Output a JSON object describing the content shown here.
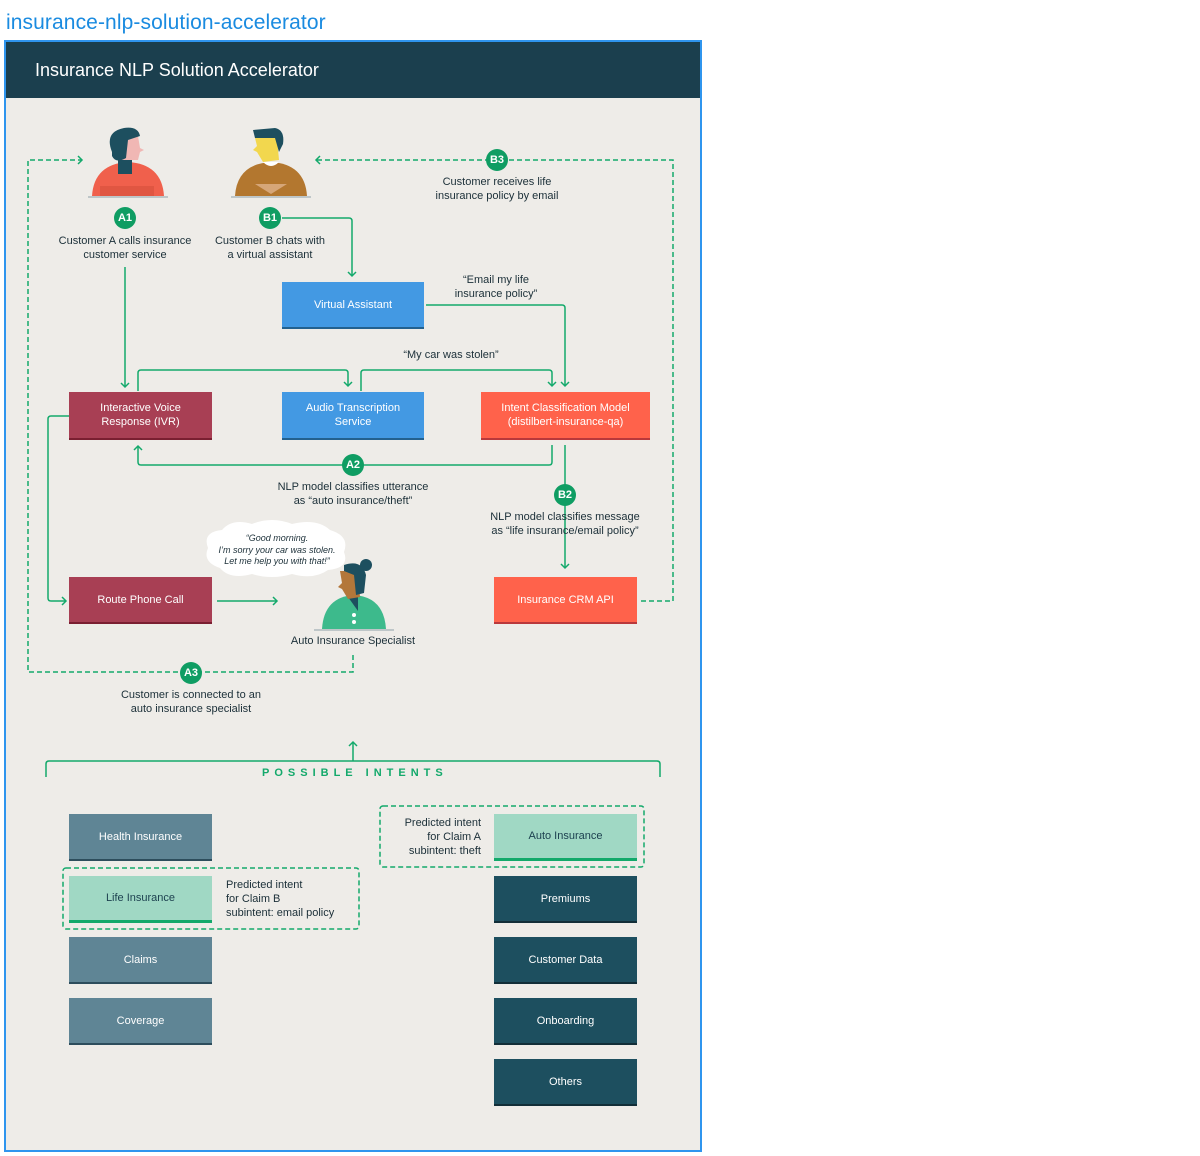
{
  "page": {
    "title": "insurance-nlp-solution-accelerator"
  },
  "header": {
    "title": "Insurance NLP Solution Accelerator"
  },
  "colors": {
    "accent_green": "#13a96b",
    "badge_green": "#0f9d63",
    "header_bg": "#1b3f4e",
    "canvas_bg": "#eeece8",
    "frame_border": "#2f95ee",
    "ivr_red": "#a83f54",
    "service_blue": "#4399e3",
    "model_orange": "#ff624b",
    "intent_slate": "#5f8595",
    "intent_dark": "#1d4f5f",
    "intent_highlight": "#a0d8c4"
  },
  "steps": {
    "a1": {
      "badge": "A1",
      "text_line1": "Customer A calls insurance",
      "text_line2": "customer service"
    },
    "b1": {
      "badge": "B1",
      "text_line1": "Customer B chats with",
      "text_line2": "a virtual assistant"
    },
    "b3": {
      "badge": "B3",
      "text_line1": "Customer receives life",
      "text_line2": "insurance policy by email"
    },
    "a2": {
      "badge": "A2",
      "text_line1": "NLP model classifies utterance",
      "text_line2": "as “auto insurance/theft”"
    },
    "b2": {
      "badge": "B2",
      "text_line1": "NLP model classifies message",
      "text_line2": "as “life insurance/email policy”"
    },
    "a3": {
      "badge": "A3",
      "text_line1": "Customer is connected to an",
      "text_line2": "auto insurance specialist"
    }
  },
  "quotes": {
    "email_policy_line1": "“Email my life",
    "email_policy_line2": "insurance policy”",
    "car_stolen": "“My car was stolen”",
    "specialist_line1": "“Good morning.",
    "specialist_line2": "I’m sorry your car was stolen.",
    "specialist_line3": "Let me help you with that!”"
  },
  "nodes": {
    "virtual_assistant": "Virtual Assistant",
    "ivr_line1": "Interactive Voice",
    "ivr_line2": "Response (IVR)",
    "audio_line1": "Audio Transcription",
    "audio_line2": "Service",
    "model_line1": "Intent Classification Model",
    "model_line2": "(distilbert-insurance-qa)",
    "route_call": "Route Phone Call",
    "crm_api": "Insurance CRM API",
    "specialist": "Auto Insurance Specialist"
  },
  "figures": {
    "customer_a": "person-woman-icon",
    "customer_b": "person-man-icon",
    "specialist": "person-specialist-icon"
  },
  "intents": {
    "section_title": "POSSIBLE INTENTS",
    "left": [
      {
        "label": "Health Insurance",
        "style": "slate"
      },
      {
        "label": "Life Insurance",
        "style": "highlight"
      },
      {
        "label": "Claims",
        "style": "slate"
      },
      {
        "label": "Coverage",
        "style": "slate"
      }
    ],
    "right": [
      {
        "label": "Auto Insurance",
        "style": "highlight"
      },
      {
        "label": "Premiums",
        "style": "dark"
      },
      {
        "label": "Customer Data",
        "style": "dark"
      },
      {
        "label": "Onboarding",
        "style": "dark"
      },
      {
        "label": "Others",
        "style": "dark"
      }
    ],
    "claim_b_note": {
      "line1": "Predicted intent",
      "line2": "for Claim B",
      "line3": "subintent: email policy"
    },
    "claim_a_note": {
      "line1": "Predicted intent",
      "line2": "for Claim A",
      "line3": "subintent: theft"
    }
  }
}
